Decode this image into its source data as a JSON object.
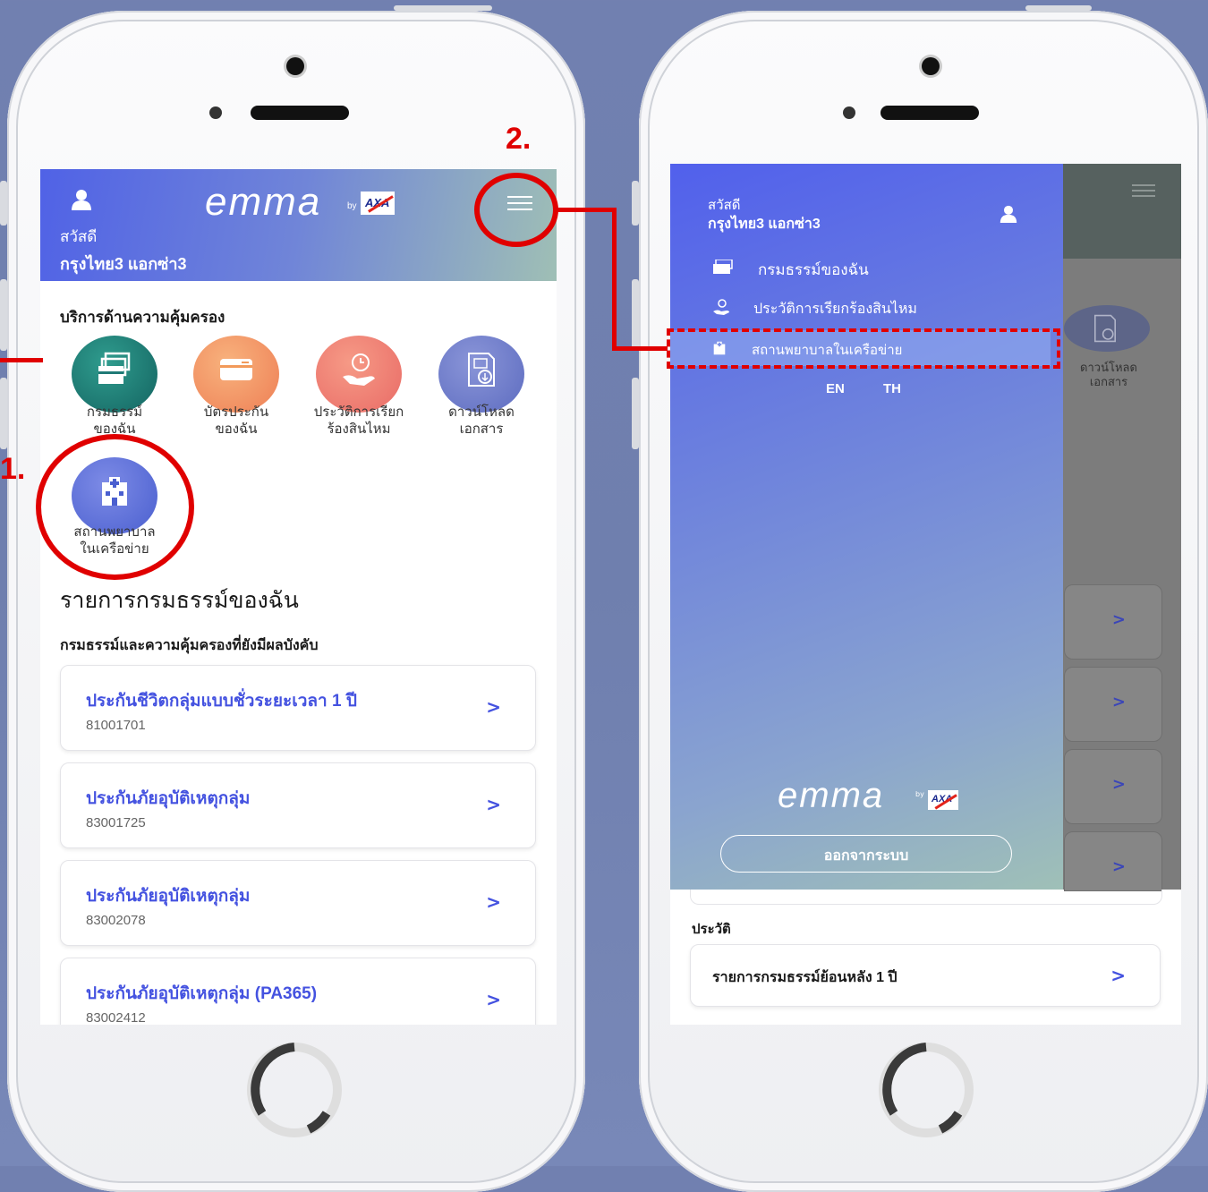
{
  "left_screen": {
    "header": {
      "logo_text": "emma",
      "logo_by": "by",
      "logo_brand": "AXA",
      "greeting": "สวัสดี",
      "user_name": "กรุงไทย3 แอกซ่า3"
    },
    "services_heading": "บริการด้านความคุ้มครอง",
    "services": [
      {
        "label": "กรมธรรม์\nของฉัน",
        "icon": "policy-cards-icon",
        "color": "#1f7a76"
      },
      {
        "label": "บัตรประกัน\nของฉัน",
        "icon": "insurance-card-icon",
        "color": "#f29a5a"
      },
      {
        "label": "ประวัติการเรียก\nร้องสินไหม",
        "icon": "claim-history-icon",
        "color": "#f07a72"
      },
      {
        "label": "ดาวน์โหลด\nเอกสาร",
        "icon": "download-document-icon",
        "color": "#6b78c8"
      },
      {
        "label": "สถานพยาบาล\nในเครือข่าย",
        "icon": "hospital-icon",
        "color": "#5d6fd8"
      }
    ],
    "policy_list_title": "รายการกรมธรรม์ของฉัน",
    "policy_list_subtitle": "กรมธรรม์และความคุ้มครองที่ยังมีผลบังคับ",
    "policies": [
      {
        "title": "ประกันชีวิตกลุ่มแบบชั่วระยะเวลา 1 ปี",
        "number": "81001701"
      },
      {
        "title": "ประกันภัยอุบัติเหตุกลุ่ม",
        "number": "83001725"
      },
      {
        "title": "ประกันภัยอุบัติเหตุกลุ่ม",
        "number": "83002078"
      },
      {
        "title": "ประกันภัยอุบัติเหตุกลุ่ม (PA365)",
        "number": "83002412"
      }
    ]
  },
  "right_screen": {
    "menu": {
      "greeting": "สวัสดี",
      "user_name": "กรุงไทย3 แอกซ่า3",
      "items": [
        {
          "label": "กรมธรรม์ของฉัน",
          "icon": "policy-icon"
        },
        {
          "label": "ประวัติการเรียกร้องสินไหม",
          "icon": "claim-icon"
        },
        {
          "label": "สถานพยาบาลในเครือข่าย",
          "icon": "hospital-icon"
        }
      ],
      "lang_en": "EN",
      "lang_th": "TH",
      "logo_text": "emma",
      "logout_label": "ออกจากระบบ"
    },
    "background": {
      "download_label": "ดาวน์โหลด\nเอกสาร",
      "history_heading": "ประวัติ",
      "history_item": "รายการกรมธรรม์ย้อนหลัง 1 ปี"
    }
  },
  "annotations": {
    "step1": "1.",
    "step2": "2.",
    "highlight_color": "#e00000"
  }
}
